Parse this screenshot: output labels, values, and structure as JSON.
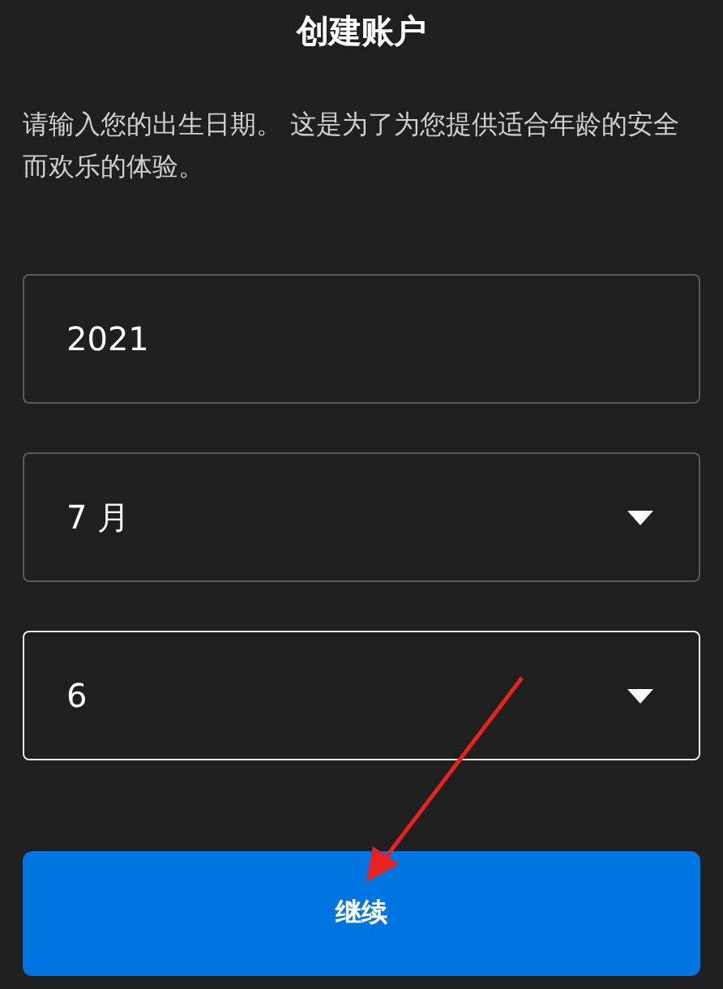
{
  "title": "创建账户",
  "description": "请输入您的出生日期。 这是为了为您提供适合年龄的安全而欢乐的体验。",
  "fields": [
    {
      "kind": "text",
      "value": "2021",
      "focused": false
    },
    {
      "kind": "select",
      "value": "7 月",
      "focused": false
    },
    {
      "kind": "select",
      "value": "6",
      "focused": true
    }
  ],
  "button": "继续"
}
